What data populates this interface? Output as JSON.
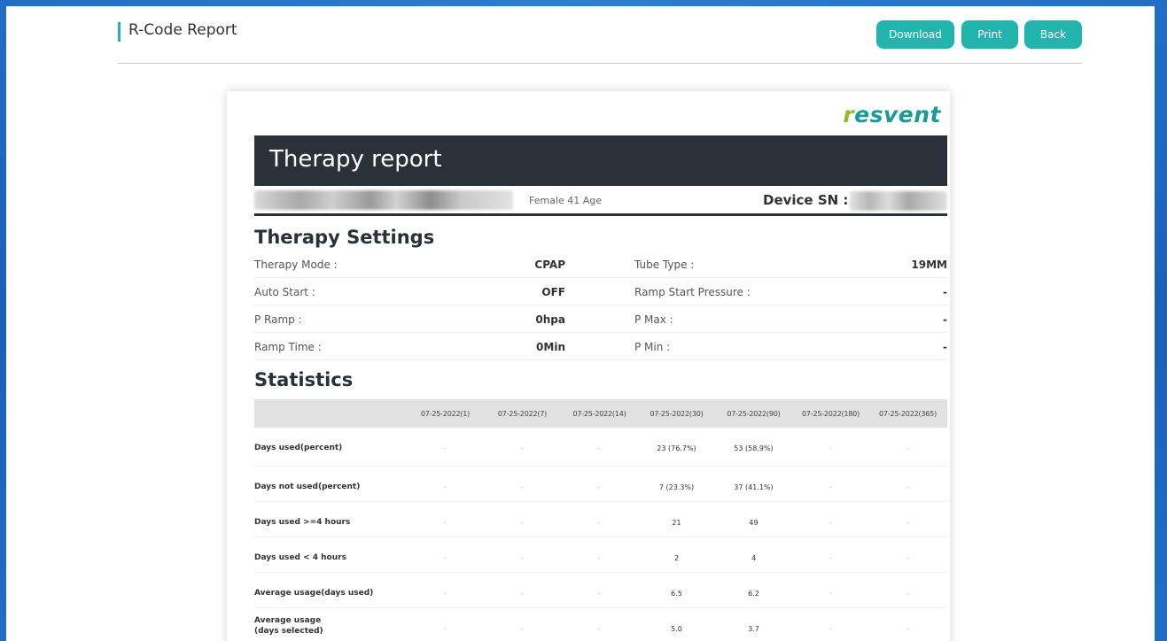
{
  "header": {
    "title": "R-Code Report",
    "buttons": {
      "download": "Download",
      "print": "Print",
      "back": "Back"
    }
  },
  "report": {
    "logo": {
      "first": "r",
      "rest": "esvent"
    },
    "banner_title": "Therapy report",
    "patient": {
      "info": "Female  41 Age"
    },
    "device_sn_label": "Device SN :",
    "settings_title": "Therapy Settings",
    "settings": [
      {
        "label": "Therapy Mode :",
        "value": "CPAP",
        "label2": "Tube Type :",
        "value2": "19MM"
      },
      {
        "label": "Auto Start :",
        "value": "OFF",
        "label2": "Ramp Start Pressure :",
        "value2": "-"
      },
      {
        "label": "P Ramp :",
        "value": "0hpa",
        "label2": "P Max :",
        "value2": "-"
      },
      {
        "label": "Ramp Time :",
        "value": "0Min",
        "label2": "P Min :",
        "value2": "-"
      }
    ],
    "stats_title": "Statistics",
    "stats_columns": [
      "07-25-2022(1)",
      "07-25-2022(7)",
      "07-25-2022(14)",
      "07-25-2022(30)",
      "07-25-2022(90)",
      "07-25-2022(180)",
      "07-25-2022(365)"
    ],
    "stats_rows": [
      {
        "label": "Days used(percent)",
        "values": [
          "-",
          "-",
          "-",
          "23 (76.7%)",
          "53 (58.9%)",
          "-",
          "-"
        ]
      },
      {
        "label": "Days not used(percent)",
        "values": [
          "-",
          "-",
          "-",
          "7 (23.3%)",
          "37 (41.1%)",
          "-",
          "-"
        ]
      },
      {
        "label": "Days used >=4 hours",
        "values": [
          "-",
          "-",
          "-",
          "21",
          "49",
          "-",
          "-"
        ]
      },
      {
        "label": "Days used < 4 hours",
        "values": [
          "-",
          "-",
          "-",
          "2",
          "4",
          "-",
          "-"
        ]
      },
      {
        "label": "Average usage(days used)",
        "values": [
          "-",
          "-",
          "-",
          "6.5",
          "6.2",
          "-",
          "-"
        ]
      },
      {
        "label_line1": "Average usage",
        "label_line2": "(days selected)",
        "values": [
          "-",
          "-",
          "-",
          "5.0",
          "3.7",
          "-",
          "-"
        ]
      }
    ]
  }
}
